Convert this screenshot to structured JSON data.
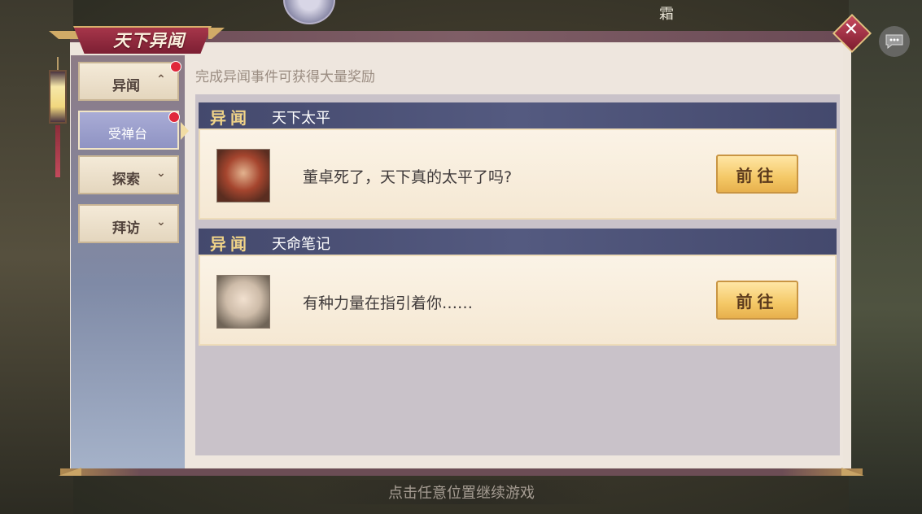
{
  "window": {
    "title": "天下异闻"
  },
  "top": {
    "glyph": "霜"
  },
  "sidebar": {
    "items": [
      {
        "label": "异闻",
        "chevron": "up",
        "badge": true
      },
      {
        "label": "受禅台",
        "active": true,
        "badge": true
      },
      {
        "label": "探索",
        "chevron": "down",
        "badge": false
      },
      {
        "label": "拜访",
        "chevron": "down",
        "badge": false
      }
    ]
  },
  "main": {
    "hint": "完成异闻事件可获得大量奖励",
    "events": [
      {
        "tag": "异闻",
        "name": "天下太平",
        "desc": "董卓死了，天下真的太平了吗?",
        "button": "前往",
        "portrait": "red-helmet-warrior-portrait"
      },
      {
        "tag": "异闻",
        "name": "天命笔记",
        "desc": "有种力量在指引着你……",
        "button": "前往",
        "portrait": "silver-haired-sage-portrait"
      }
    ]
  },
  "footer": {
    "hint": "点击任意位置继续游戏"
  },
  "icons": {
    "close": "close-icon",
    "chat": "chat-icon",
    "chevron_up": "chevron-up-icon",
    "chevron_down": "chevron-down-icon"
  },
  "colors": {
    "accent": "#7c1f33",
    "header": "#44496d",
    "button": "#f4c866",
    "badge": "#e0283b"
  }
}
